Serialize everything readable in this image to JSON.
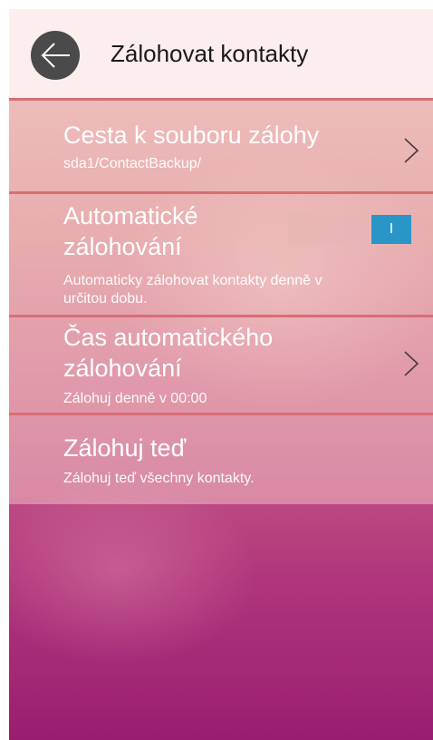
{
  "header": {
    "title": "Zálohovat kontakty",
    "back_icon": "arrow-left-icon"
  },
  "settings": {
    "items": [
      {
        "title": "Cesta k souboru zálohy",
        "subtitle": "sda1/ContactBackup/",
        "icon": "chevron-right-icon"
      },
      {
        "title_line1": "Automatické",
        "title_line2": "zálohování",
        "subtitle_line1": "Automaticky zálohovat kontakty denně v",
        "subtitle_line2": "určitou dobu.",
        "toggle_on": true,
        "toggle_label": "I"
      },
      {
        "title_line1": "Čas automatického",
        "title_line2": "zálohování",
        "subtitle": "Zálohuj denně v 00:00",
        "icon": "chevron-right-icon"
      },
      {
        "title": "Zálohuj teď",
        "subtitle": "Zálohuj teď všechny kontakty."
      }
    ]
  },
  "colors": {
    "header_bg": "#fbeeed",
    "divider": "#d76e74",
    "toggle_on": "#2a96c8",
    "text": "#ffffff"
  }
}
